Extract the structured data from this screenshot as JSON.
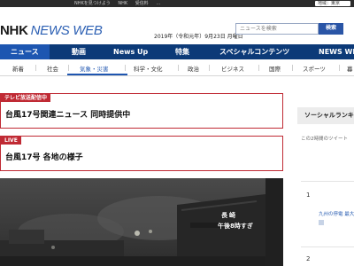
{
  "topbar": {
    "links": [
      "NHKを見つけよう",
      "NHK",
      "受信料",
      "…"
    ],
    "region_label": "地域：東京"
  },
  "header": {
    "logo_nhk": "NHK",
    "logo_newsweb": "NEWS WEB",
    "date": "2019年（令和元年）9月23日 月曜日",
    "search_placeholder": "ニュースを検索",
    "search_button": "検索"
  },
  "main_nav": {
    "items": [
      "ニュース",
      "動画",
      "News Up",
      "特集",
      "スペシャルコンテンツ",
      "NEWS WEB"
    ]
  },
  "sub_nav": {
    "items": [
      "新着",
      "社会",
      "気象・災害",
      "科学・文化",
      "政治",
      "ビジネス",
      "国際",
      "スポーツ",
      "暮"
    ]
  },
  "boxes": [
    {
      "tag": "テレビ放送配信中",
      "title": "台風17号関連ニュース 同時提供中"
    },
    {
      "tag": "LIVE",
      "title": "台風17号 各地の様子"
    }
  ],
  "side": {
    "heading": "ソーシャルランキング",
    "subtitle": "この2時間のツイート",
    "ranks": [
      {
        "num": "1",
        "text": "九州の停電 最大約1"
      },
      {
        "num": "2",
        "text": ""
      }
    ]
  },
  "video": {
    "overlay_location": "長崎",
    "overlay_time": "午後8時すぎ"
  },
  "colors": {
    "nav_blue": "#0c3a78",
    "nav_active": "#1d56b1",
    "alert_red": "#c02a34",
    "logo_blue": "#2b5fb3"
  }
}
